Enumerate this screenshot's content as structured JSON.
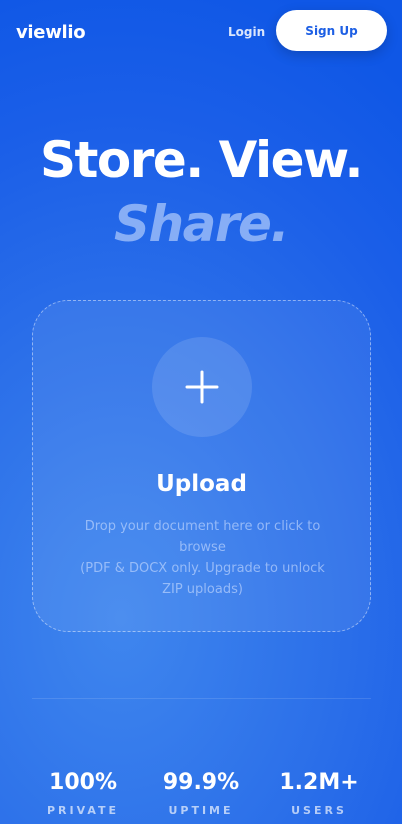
{
  "header": {
    "logo": "viewlio",
    "login_label": "Login",
    "signup_label": "Sign Up"
  },
  "hero": {
    "title": "Store. View.",
    "subtitle": "Share."
  },
  "upload": {
    "icon": "plus-icon",
    "title": "Upload",
    "description_line1": "Drop your document here or click to browse",
    "description_line2": "(PDF & DOCX only. Upgrade to unlock ZIP uploads)"
  },
  "stats": [
    {
      "value": "100%",
      "label": "PRIVATE"
    },
    {
      "value": "99.9%",
      "label": "UPTIME"
    },
    {
      "value": "1.2M+",
      "label": "USERS"
    }
  ],
  "colors": {
    "background": "#1b5fe8",
    "accent_text": "#87aef6",
    "button_bg": "#ffffff",
    "button_text": "#1d5fe4"
  }
}
